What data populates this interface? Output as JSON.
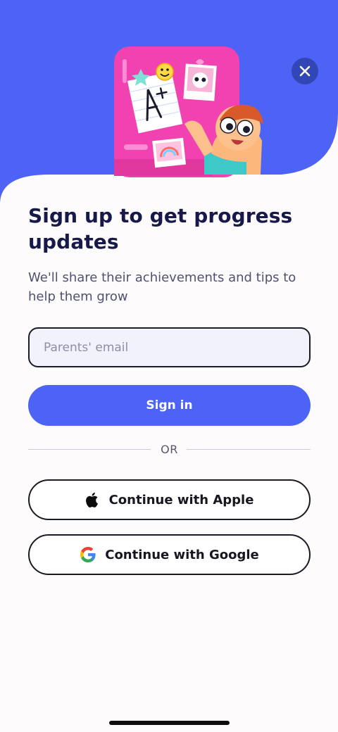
{
  "hero": {
    "illustration_icon": "report-card-illustration-icon",
    "colors": {
      "background": "#4d63f6",
      "fridge": "#f242b2"
    }
  },
  "close_button": {
    "icon": "close-icon"
  },
  "header": {
    "title": "Sign up to get progress updates",
    "subtitle": "We'll share their achievements and tips to help them grow"
  },
  "form": {
    "email_placeholder": "Parents' email",
    "email_value": "",
    "sign_in_label": "Sign in"
  },
  "divider": {
    "label": "OR"
  },
  "social": {
    "apple_label": "Continue with Apple",
    "apple_icon": "apple-icon",
    "google_label": "Continue with Google",
    "google_icon": "google-icon"
  },
  "colors": {
    "accent": "#4d63f6",
    "text_primary": "#171a49",
    "text_secondary": "#4e5270"
  }
}
